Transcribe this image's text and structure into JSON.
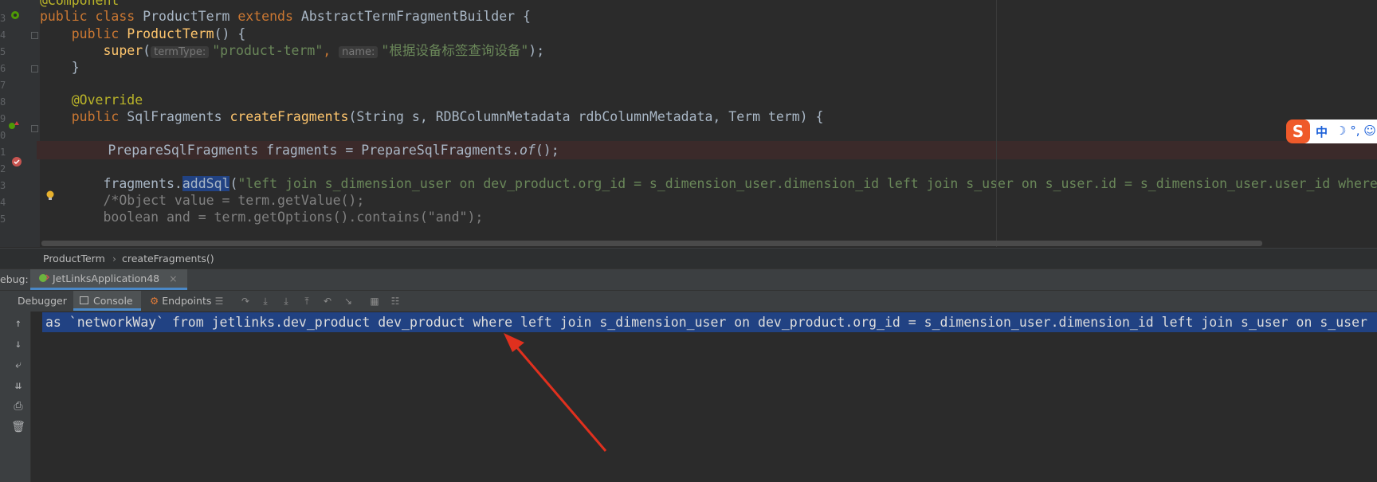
{
  "editor": {
    "line_numbers": [
      "3",
      "4",
      "5",
      "6",
      "7",
      "8",
      "9",
      "0",
      "1",
      "2",
      "3",
      "4",
      "5"
    ],
    "lines": {
      "l1": {
        "annotation": "@Component"
      },
      "l2": {
        "kw1": "public class ",
        "name": "ProductTerm ",
        "kw2": "extends ",
        "parent": "AbstractTermFragmentBuilder",
        "rest": " {"
      },
      "l3": {
        "kw": "public ",
        "fn": "ProductTerm",
        "rest": "() {"
      },
      "l4": {
        "fn": "super",
        "open": "(",
        "hint1": "termType:",
        "str1": "\"product-term\"",
        "comma": ", ",
        "hint2": "name:",
        "str2": "\"根据设备标签查询设备\"",
        "close": ");"
      },
      "l5": {
        "text": "}"
      },
      "l7": {
        "annotation": "@Override"
      },
      "l8": {
        "kw": "public ",
        "type": "SqlFragments ",
        "fn": "createFragments",
        "params": "(String s, RDBColumnMetadata rdbColumnMetadata, Term term) {"
      },
      "l10": {
        "pre": "PrepareSqlFragments fragments = PrepareSqlFragments.",
        "method": "of",
        "post": "();"
      },
      "l12": {
        "pre": "fragments.",
        "sel": "addSql",
        "open": "(",
        "str": "\"left join s_dimension_user on dev_product.org_id = s_dimension_user.dimension_id left join s_user on s_user.id = s_dimension_user.user_id where"
      },
      "l13": {
        "text": "/*Object value = term.getValue();"
      },
      "l14": {
        "text": "boolean and = term.getOptions().contains(\"and\");"
      }
    }
  },
  "breadcrumb": {
    "class_name": "ProductTerm",
    "separator": "›",
    "method": "createFragments()"
  },
  "debug": {
    "label": "ebug:",
    "run_config": "JetLinksApplication48"
  },
  "subtabs": {
    "debugger": "Debugger",
    "console": "Console",
    "endpoints": "Endpoints"
  },
  "console": {
    "output": "as `networkWay` from jetlinks.dev_product dev_product where left join s_dimension_user on dev_product.org_id = s_dimension_user.dimension_id left join s_user on s_user"
  },
  "ime": {
    "logo": "S",
    "mode": "中",
    "items": "☽ °, ☺"
  },
  "colors": {
    "selection": "#214283",
    "annotation_arrow": "#e0301e",
    "keyword": "#cc7832",
    "string": "#6a8759",
    "function": "#ffc66d"
  }
}
